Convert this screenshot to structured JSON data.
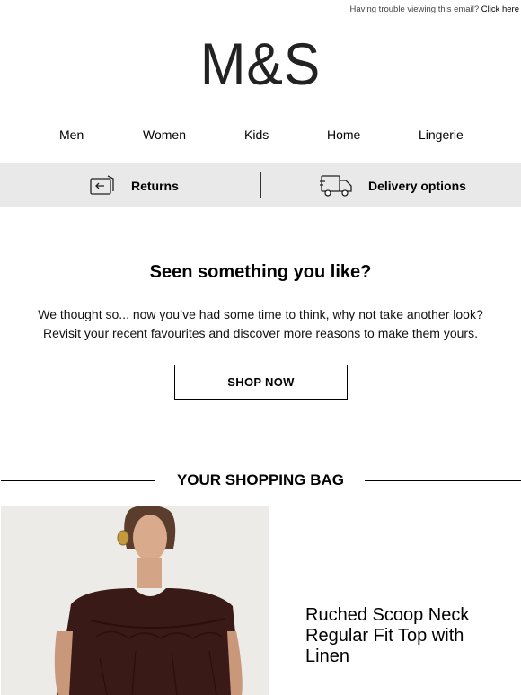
{
  "topbar": {
    "trouble_text": "Having trouble viewing this email?",
    "click_here": "Click here"
  },
  "brand": {
    "logo_text": "M&S"
  },
  "nav": {
    "items": [
      {
        "label": "Men"
      },
      {
        "label": "Women"
      },
      {
        "label": "Kids"
      },
      {
        "label": "Home"
      },
      {
        "label": "Lingerie"
      }
    ]
  },
  "services": {
    "returns": {
      "label": "Returns",
      "icon": "returns-card-icon"
    },
    "delivery": {
      "label": "Delivery options",
      "icon": "delivery-truck-icon"
    }
  },
  "hero": {
    "headline": "Seen something you like?",
    "line1": "We thought so... now you’ve had some time to think, why not take another look?",
    "line2": "Revisit your recent favourites and discover more reasons to make them yours.",
    "cta": "SHOP NOW"
  },
  "bag": {
    "title": "YOUR SHOPPING BAG",
    "product": {
      "name": "Ruched Scoop Neck Regular Fit Top with Linen",
      "image_alt": "Model wearing brown ruched scoop neck top"
    }
  },
  "colors": {
    "service_bar_bg": "#e9e9e9",
    "product_colour": "#3a1a16"
  }
}
